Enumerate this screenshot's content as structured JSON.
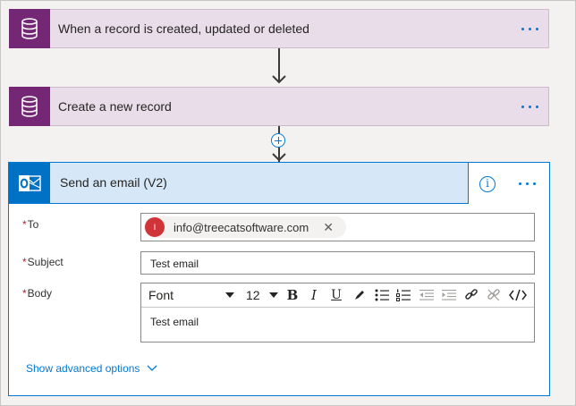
{
  "trigger_card": {
    "title": "When a record is created, updated or deleted",
    "icon": "database-icon",
    "menu_icon": "more-icon"
  },
  "create_card": {
    "title": "Create a new record",
    "icon": "database-icon",
    "menu_icon": "more-icon"
  },
  "insert_step": {
    "icon": "plus-icon"
  },
  "email_card": {
    "title": "Send an email (V2)",
    "icon": "outlook-icon",
    "info_glyph": "i",
    "fields": {
      "to": {
        "label": "To",
        "recipient_initial": "I",
        "recipient": "info@treecatsoftware.com",
        "remove_glyph": "✕"
      },
      "subject": {
        "label": "Subject",
        "value": "Test email"
      },
      "body": {
        "label": "Body",
        "font": "Font",
        "size": "12",
        "bold": "B",
        "italic": "I",
        "underline": "U",
        "value": "Test email"
      }
    },
    "advanced": "Show advanced options"
  },
  "colors": {
    "accent": "#0078d4",
    "dataverse": "#742774",
    "dataverse_tint": "#e9dde9",
    "outlook": "#0072c6",
    "required": "#a4262c"
  }
}
